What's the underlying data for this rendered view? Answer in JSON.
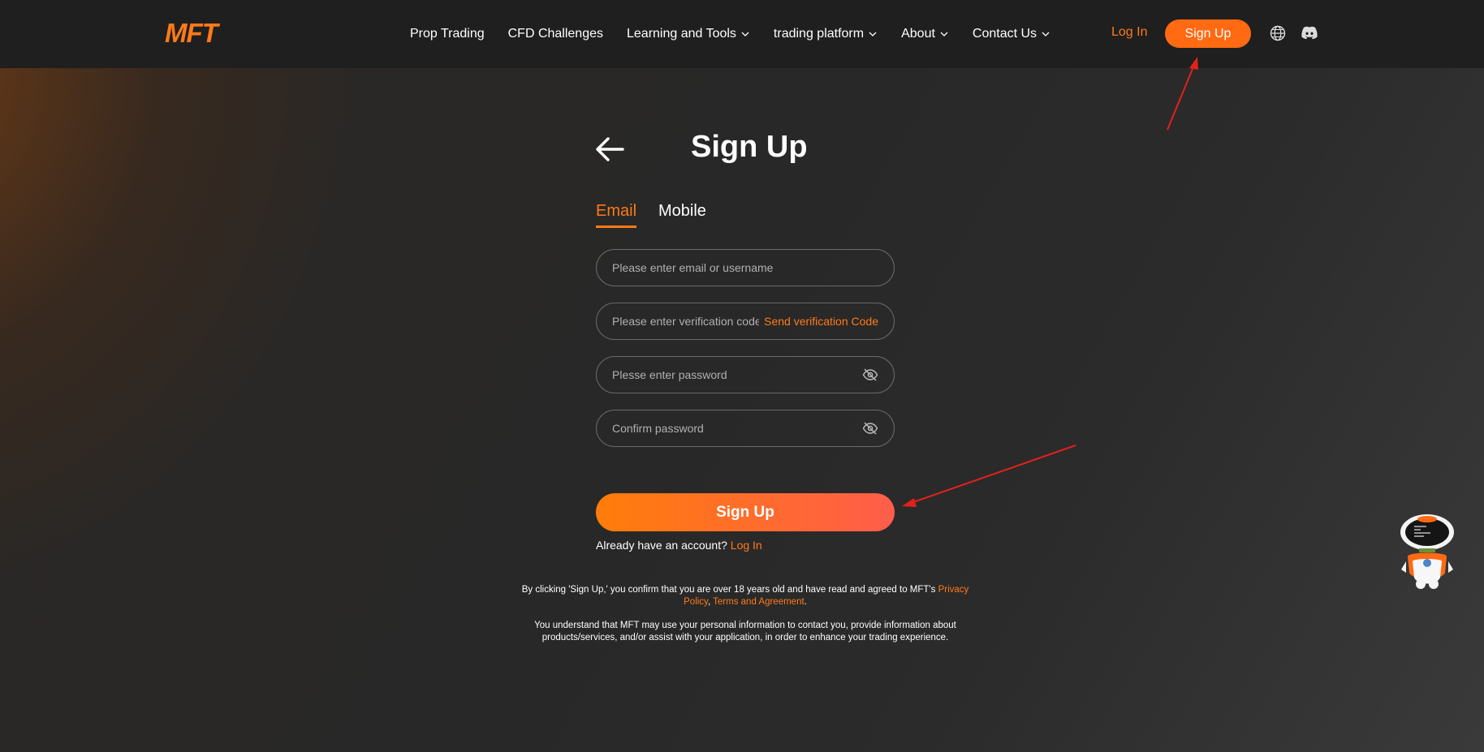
{
  "header": {
    "logo": "MFT",
    "nav": [
      {
        "label": "Prop Trading",
        "dropdown": false
      },
      {
        "label": "CFD Challenges",
        "dropdown": false
      },
      {
        "label": "Learning and Tools",
        "dropdown": true
      },
      {
        "label": "trading platform",
        "dropdown": true
      },
      {
        "label": "About",
        "dropdown": true
      },
      {
        "label": "Contact Us",
        "dropdown": true
      }
    ],
    "login_label": "Log In",
    "signup_label": "Sign Up",
    "icons": [
      "globe-icon",
      "discord-icon"
    ]
  },
  "form": {
    "title": "Sign Up",
    "tabs": {
      "email": "Email",
      "mobile": "Mobile",
      "active": "Email"
    },
    "email_placeholder": "Please enter email or username",
    "code_placeholder": "Please enter verification code",
    "send_code_label": "Send verification Code",
    "password_placeholder": "Plesse enter password",
    "confirm_placeholder": "Confirm password",
    "submit_label": "Sign Up",
    "already_text": "Already have an account?",
    "login_link": "Log In"
  },
  "legal": {
    "line1_prefix": "By clicking 'Sign Up,' you confirm that you are over 18 years old and have read and agreed to MFT's",
    "privacy": "Privacy Policy",
    "separator": ",",
    "terms": "Terms and Agreement",
    "period": ".",
    "line2": "You understand that MFT may use your personal information to contact you, provide information about products/services, and/or assist with your application, in order to enhance your trading experience."
  },
  "colors": {
    "accent": "#ff7a18",
    "header_bg": "#1f1f1f",
    "page_bg": "#2a2a2a",
    "annotation": "#e3211c"
  }
}
